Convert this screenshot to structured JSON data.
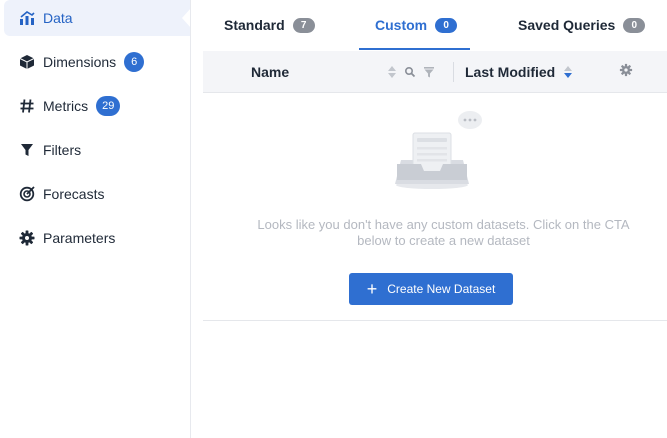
{
  "sidebar": {
    "items": [
      {
        "label": "Data",
        "icon": "chart-icon",
        "badge": null,
        "active": true
      },
      {
        "label": "Dimensions",
        "icon": "cube-icon",
        "badge": "6"
      },
      {
        "label": "Metrics",
        "icon": "hash-icon",
        "badge": "29"
      },
      {
        "label": "Filters",
        "icon": "filter-icon",
        "badge": null
      },
      {
        "label": "Forecasts",
        "icon": "target-icon",
        "badge": null
      },
      {
        "label": "Parameters",
        "icon": "gear-icon",
        "badge": null
      }
    ]
  },
  "tabs": [
    {
      "label": "Standard",
      "count": "7"
    },
    {
      "label": "Custom",
      "count": "0",
      "active": true
    },
    {
      "label": "Saved Queries",
      "count": "0"
    }
  ],
  "table": {
    "col_name": "Name",
    "col_modified": "Last Modified"
  },
  "empty_state": {
    "message": "Looks like you don't have any custom datasets. Click on the CTA below to create a new dataset",
    "cta_label": "Create New Dataset"
  },
  "colors": {
    "accent": "#2f6fd1",
    "muted_badge": "#8a8f98"
  }
}
